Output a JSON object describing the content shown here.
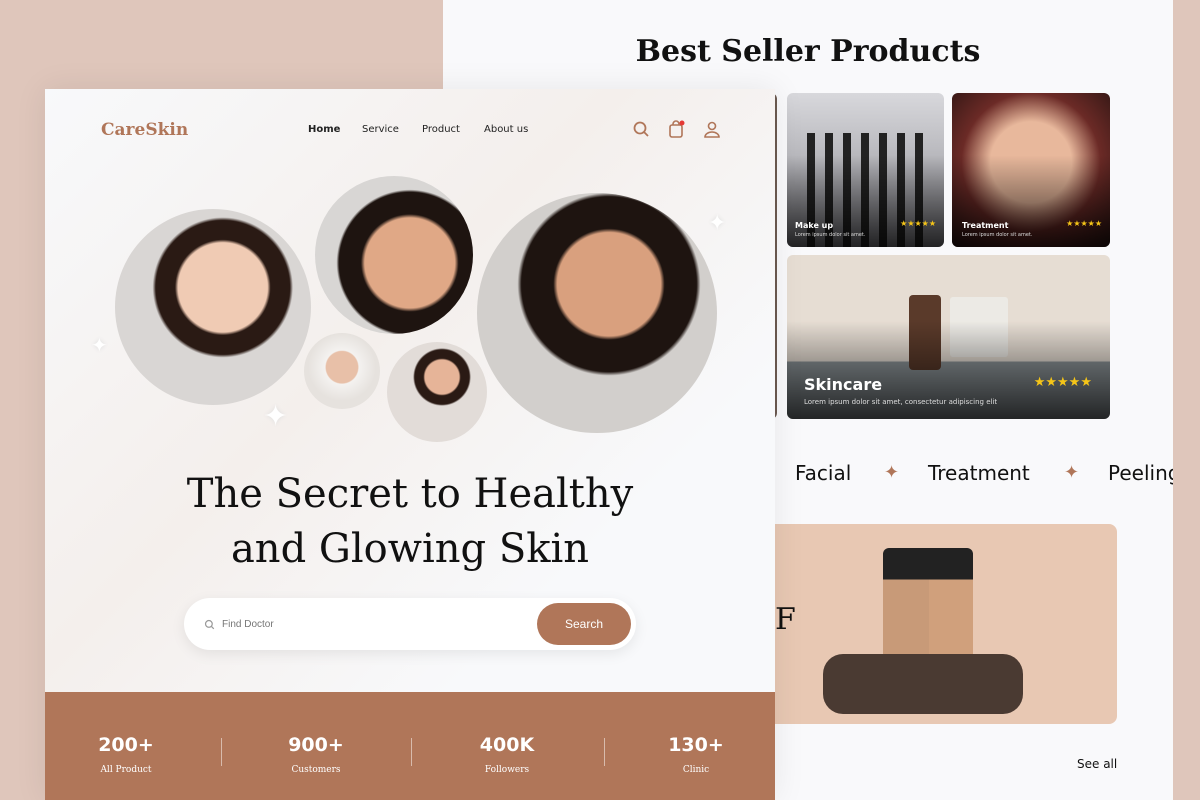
{
  "colors": {
    "accent": "#b07659",
    "background": "#dfc6bb",
    "banner": "#e8c8b3",
    "star": "#f5c518"
  },
  "back": {
    "title": "Best Seller Products",
    "cards": [
      {
        "title": "Make up",
        "desc": "Lorem ipsum dolor sit amet.",
        "rating": 5,
        "stars": "★★★★★"
      },
      {
        "title": "Treatment",
        "desc": "Lorem ipsum dolor sit amet.",
        "rating": 5,
        "stars": "★★★★★"
      },
      {
        "title": "Skincare",
        "desc": "Lorem ipsum dolor sit amet, consectetur adipiscing elit",
        "rating": 5,
        "stars": "★★★★★"
      }
    ],
    "categories": [
      "Facial",
      "Treatment",
      "Peeling"
    ],
    "separator": "✦",
    "banner_letter": "F",
    "see_all": "See all"
  },
  "front": {
    "logo": "CareSkin",
    "nav": [
      "Home",
      "Service",
      "Product",
      "About us"
    ],
    "icons": [
      "search-icon",
      "bag-icon",
      "user-icon"
    ],
    "headline_1": "The Secret to Healthy",
    "headline_2": "and Glowing Skin",
    "search_placeholder": "Find Doctor",
    "search_button": "Search",
    "stats": [
      {
        "value": "200+",
        "label": "All Product"
      },
      {
        "value": "900+",
        "label": "Customers"
      },
      {
        "value": "400K",
        "label": "Followers"
      },
      {
        "value": "130+",
        "label": "Clinic"
      }
    ]
  }
}
